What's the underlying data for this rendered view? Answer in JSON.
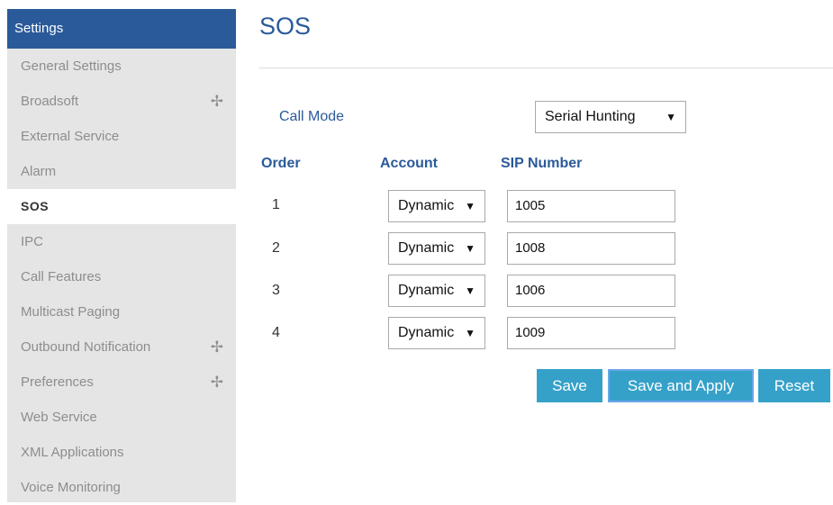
{
  "sidebar": {
    "header": "Settings",
    "items": [
      {
        "label": "General Settings",
        "expandable": false,
        "active": false
      },
      {
        "label": "Broadsoft",
        "expandable": true,
        "active": false
      },
      {
        "label": "External Service",
        "expandable": false,
        "active": false
      },
      {
        "label": "Alarm",
        "expandable": false,
        "active": false
      },
      {
        "label": "SOS",
        "expandable": false,
        "active": true
      },
      {
        "label": "IPC",
        "expandable": false,
        "active": false
      },
      {
        "label": "Call Features",
        "expandable": false,
        "active": false
      },
      {
        "label": "Multicast Paging",
        "expandable": false,
        "active": false
      },
      {
        "label": "Outbound Notification",
        "expandable": true,
        "active": false
      },
      {
        "label": "Preferences",
        "expandable": true,
        "active": false
      },
      {
        "label": "Web Service",
        "expandable": false,
        "active": false
      },
      {
        "label": "XML Applications",
        "expandable": false,
        "active": false
      },
      {
        "label": "Voice Monitoring",
        "expandable": false,
        "active": false
      }
    ],
    "expand_icon": "plus-icon"
  },
  "main": {
    "title": "SOS",
    "call_mode": {
      "label": "Call Mode",
      "value": "Serial Hunting"
    },
    "columns": {
      "order": "Order",
      "account": "Account",
      "sip": "SIP Number"
    },
    "rows": [
      {
        "order": "1",
        "account": "Dynamic",
        "sip": "1005"
      },
      {
        "order": "2",
        "account": "Dynamic",
        "sip": "1008"
      },
      {
        "order": "3",
        "account": "Dynamic",
        "sip": "1006"
      },
      {
        "order": "4",
        "account": "Dynamic",
        "sip": "1009"
      }
    ],
    "buttons": {
      "save": "Save",
      "save_apply": "Save and Apply",
      "reset": "Reset"
    }
  },
  "colors": {
    "brand": "#2a5a99",
    "button": "#35a1c9",
    "sidebar_bg": "#e5e5e5"
  }
}
